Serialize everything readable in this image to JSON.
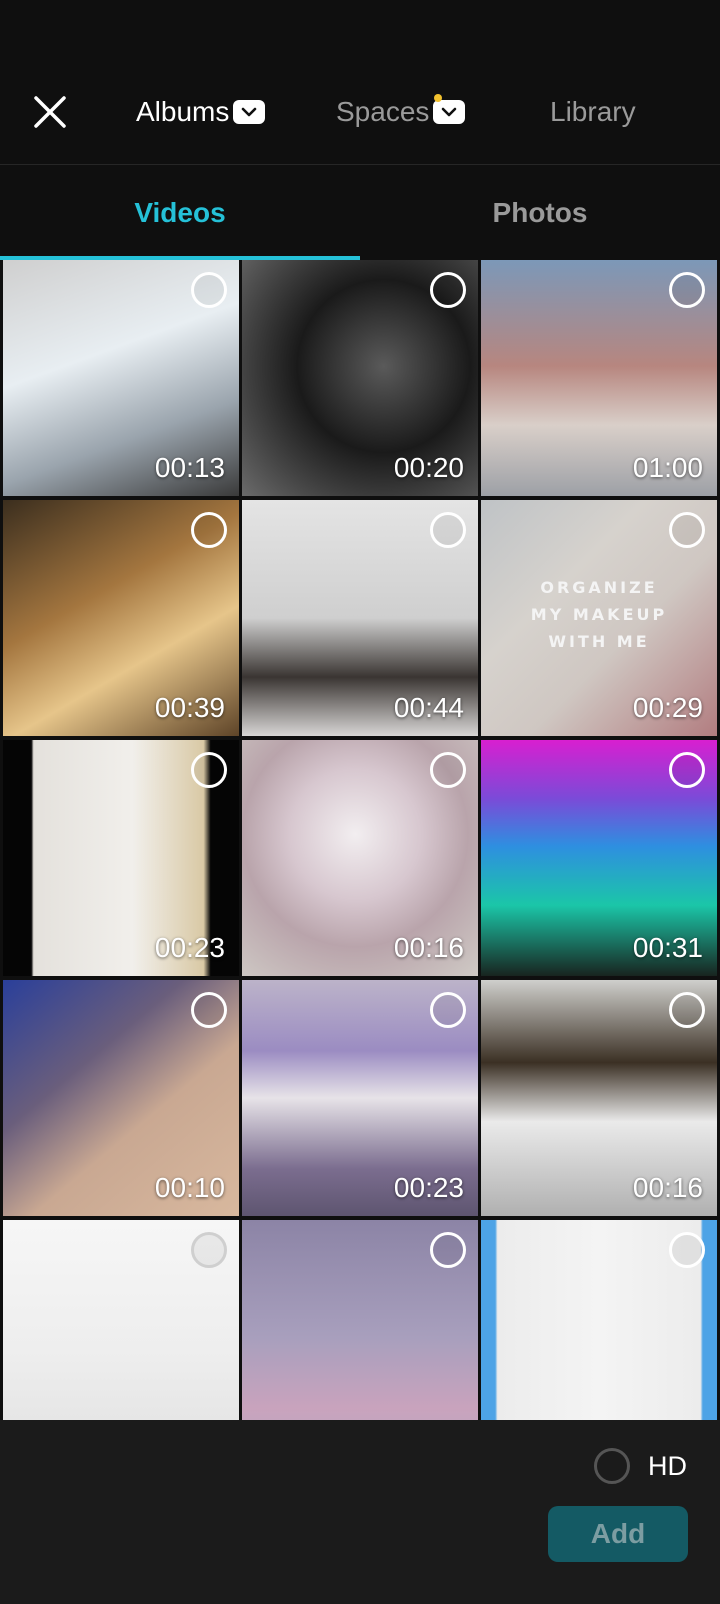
{
  "header": {
    "close_icon": "close-icon",
    "tabs": [
      {
        "label": "Albums",
        "active": true,
        "has_dropdown": true
      },
      {
        "label": "Spaces",
        "active": false,
        "has_dropdown": true,
        "has_notification_dot": true
      },
      {
        "label": "Library",
        "active": false,
        "has_dropdown": false
      }
    ]
  },
  "media_tabs": {
    "videos": "Videos",
    "photos": "Photos",
    "active": "Videos"
  },
  "grid": {
    "items": [
      {
        "duration": "00:13"
      },
      {
        "duration": "00:20"
      },
      {
        "duration": "01:00"
      },
      {
        "duration": "00:39"
      },
      {
        "duration": "00:44"
      },
      {
        "duration": "00:29",
        "overlay_lines": [
          "ORGANIZE",
          "MY MAKEUP",
          "WITH ME"
        ]
      },
      {
        "duration": "00:23"
      },
      {
        "duration": "00:16"
      },
      {
        "duration": "00:31"
      },
      {
        "duration": "00:10"
      },
      {
        "duration": "00:23"
      },
      {
        "duration": "00:16"
      },
      {
        "duration": ""
      },
      {
        "duration": ""
      },
      {
        "duration": ""
      }
    ]
  },
  "footer": {
    "hd_label": "HD",
    "add_label": "Add"
  },
  "colors": {
    "background": "#0f0f0f",
    "accent": "#25c1d8",
    "add_button": "#145a64",
    "notification_dot": "#f2c12e"
  }
}
